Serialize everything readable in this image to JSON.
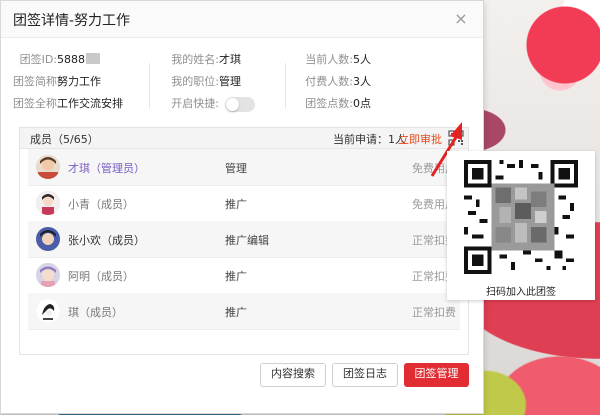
{
  "dialog": {
    "title": "团签详情-努力工作",
    "close_glyph": "×"
  },
  "info": {
    "col1": [
      {
        "label": "团签ID:",
        "value": "5888"
      },
      {
        "label": "团签简称:",
        "value": "努力工作"
      },
      {
        "label": "团签全称:",
        "value": "工作交流安排"
      }
    ],
    "col2": [
      {
        "label": "我的姓名:",
        "value": "才琪"
      },
      {
        "label": "我的职位:",
        "value": "管理"
      },
      {
        "label": "开启快捷:",
        "toggle_on": false
      }
    ],
    "col3": [
      {
        "label": "当前人数:",
        "value": "5人"
      },
      {
        "label": "付费人数:",
        "value": "3人"
      },
      {
        "label": "团签点数:",
        "value": "0点"
      }
    ]
  },
  "members": {
    "count_label": "成员（5/65）",
    "pending_label": "当前申请：1人",
    "approve_label": "立即审批",
    "rows": [
      {
        "name": "才琪（管理员）",
        "role": "管理",
        "type": "免费用户"
      },
      {
        "name": "小青（成员）",
        "role": "推广",
        "type": "免费用户"
      },
      {
        "name": "张小欢（成员）",
        "role": "推广编辑",
        "type": "正常扣费"
      },
      {
        "name": "阿明（成员）",
        "role": "推广",
        "type": "正常扣费"
      },
      {
        "name": "琪（成员）",
        "role": "推广",
        "type": "正常扣费"
      }
    ]
  },
  "buttons": {
    "content_search": "内容搜索",
    "group_log": "团签日志",
    "group_manage": "团签管理"
  },
  "qr_popup": {
    "caption": "扫码加入此团签"
  },
  "colors": {
    "accent_red": "#e12c33",
    "approve_orange": "#e54b1c",
    "admin_purple": "#7b5cc1"
  }
}
